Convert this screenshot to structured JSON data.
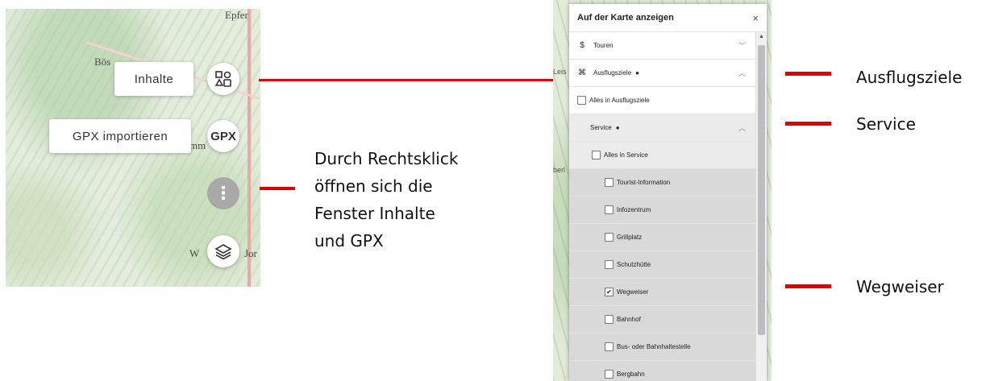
{
  "map_left": {
    "places": [
      "Epfer",
      "Bös",
      "mm",
      "W",
      "Jor"
    ],
    "labels": {
      "inhalte": "Inhalte",
      "gpx_import": "GPX importieren"
    },
    "buttons": {
      "gpx": "GPX",
      "more": "⋮",
      "content_icon": "content-icon",
      "layers_icon": "layers-icon"
    }
  },
  "annotations": {
    "right_click": [
      "Durch Rechtsklick",
      "öffnen sich die",
      "Fenster Inhalte",
      "und GPX"
    ],
    "ausflugsziele": "Ausflugsziele",
    "service": "Service",
    "wegweiser": "Wegweiser"
  },
  "panel": {
    "title": "Auf der Karte anzeigen",
    "close": "×",
    "rows": [
      {
        "label": "Touren",
        "icon": "$"
      },
      {
        "label": "Ausflugsziele",
        "icon": "⌘",
        "dot": "●"
      },
      {
        "label": "Alles in Ausflugsziele",
        "checked": false
      },
      {
        "label": "Service",
        "dot": "●"
      },
      {
        "label": "Alles in Service",
        "checked": false
      },
      {
        "label": "Tourist-Information",
        "checked": false
      },
      {
        "label": "Infozentrum",
        "checked": false
      },
      {
        "label": "Grillplatz",
        "checked": false
      },
      {
        "label": "Schutzhütte",
        "checked": false
      },
      {
        "label": "Wegweiser",
        "checked": true
      },
      {
        "label": "Bahnhof",
        "checked": false
      },
      {
        "label": "Bus- oder Bahnhaltestelle",
        "checked": false
      },
      {
        "label": "Bergbahn",
        "checked": false
      }
    ],
    "check_mark": "✔"
  }
}
